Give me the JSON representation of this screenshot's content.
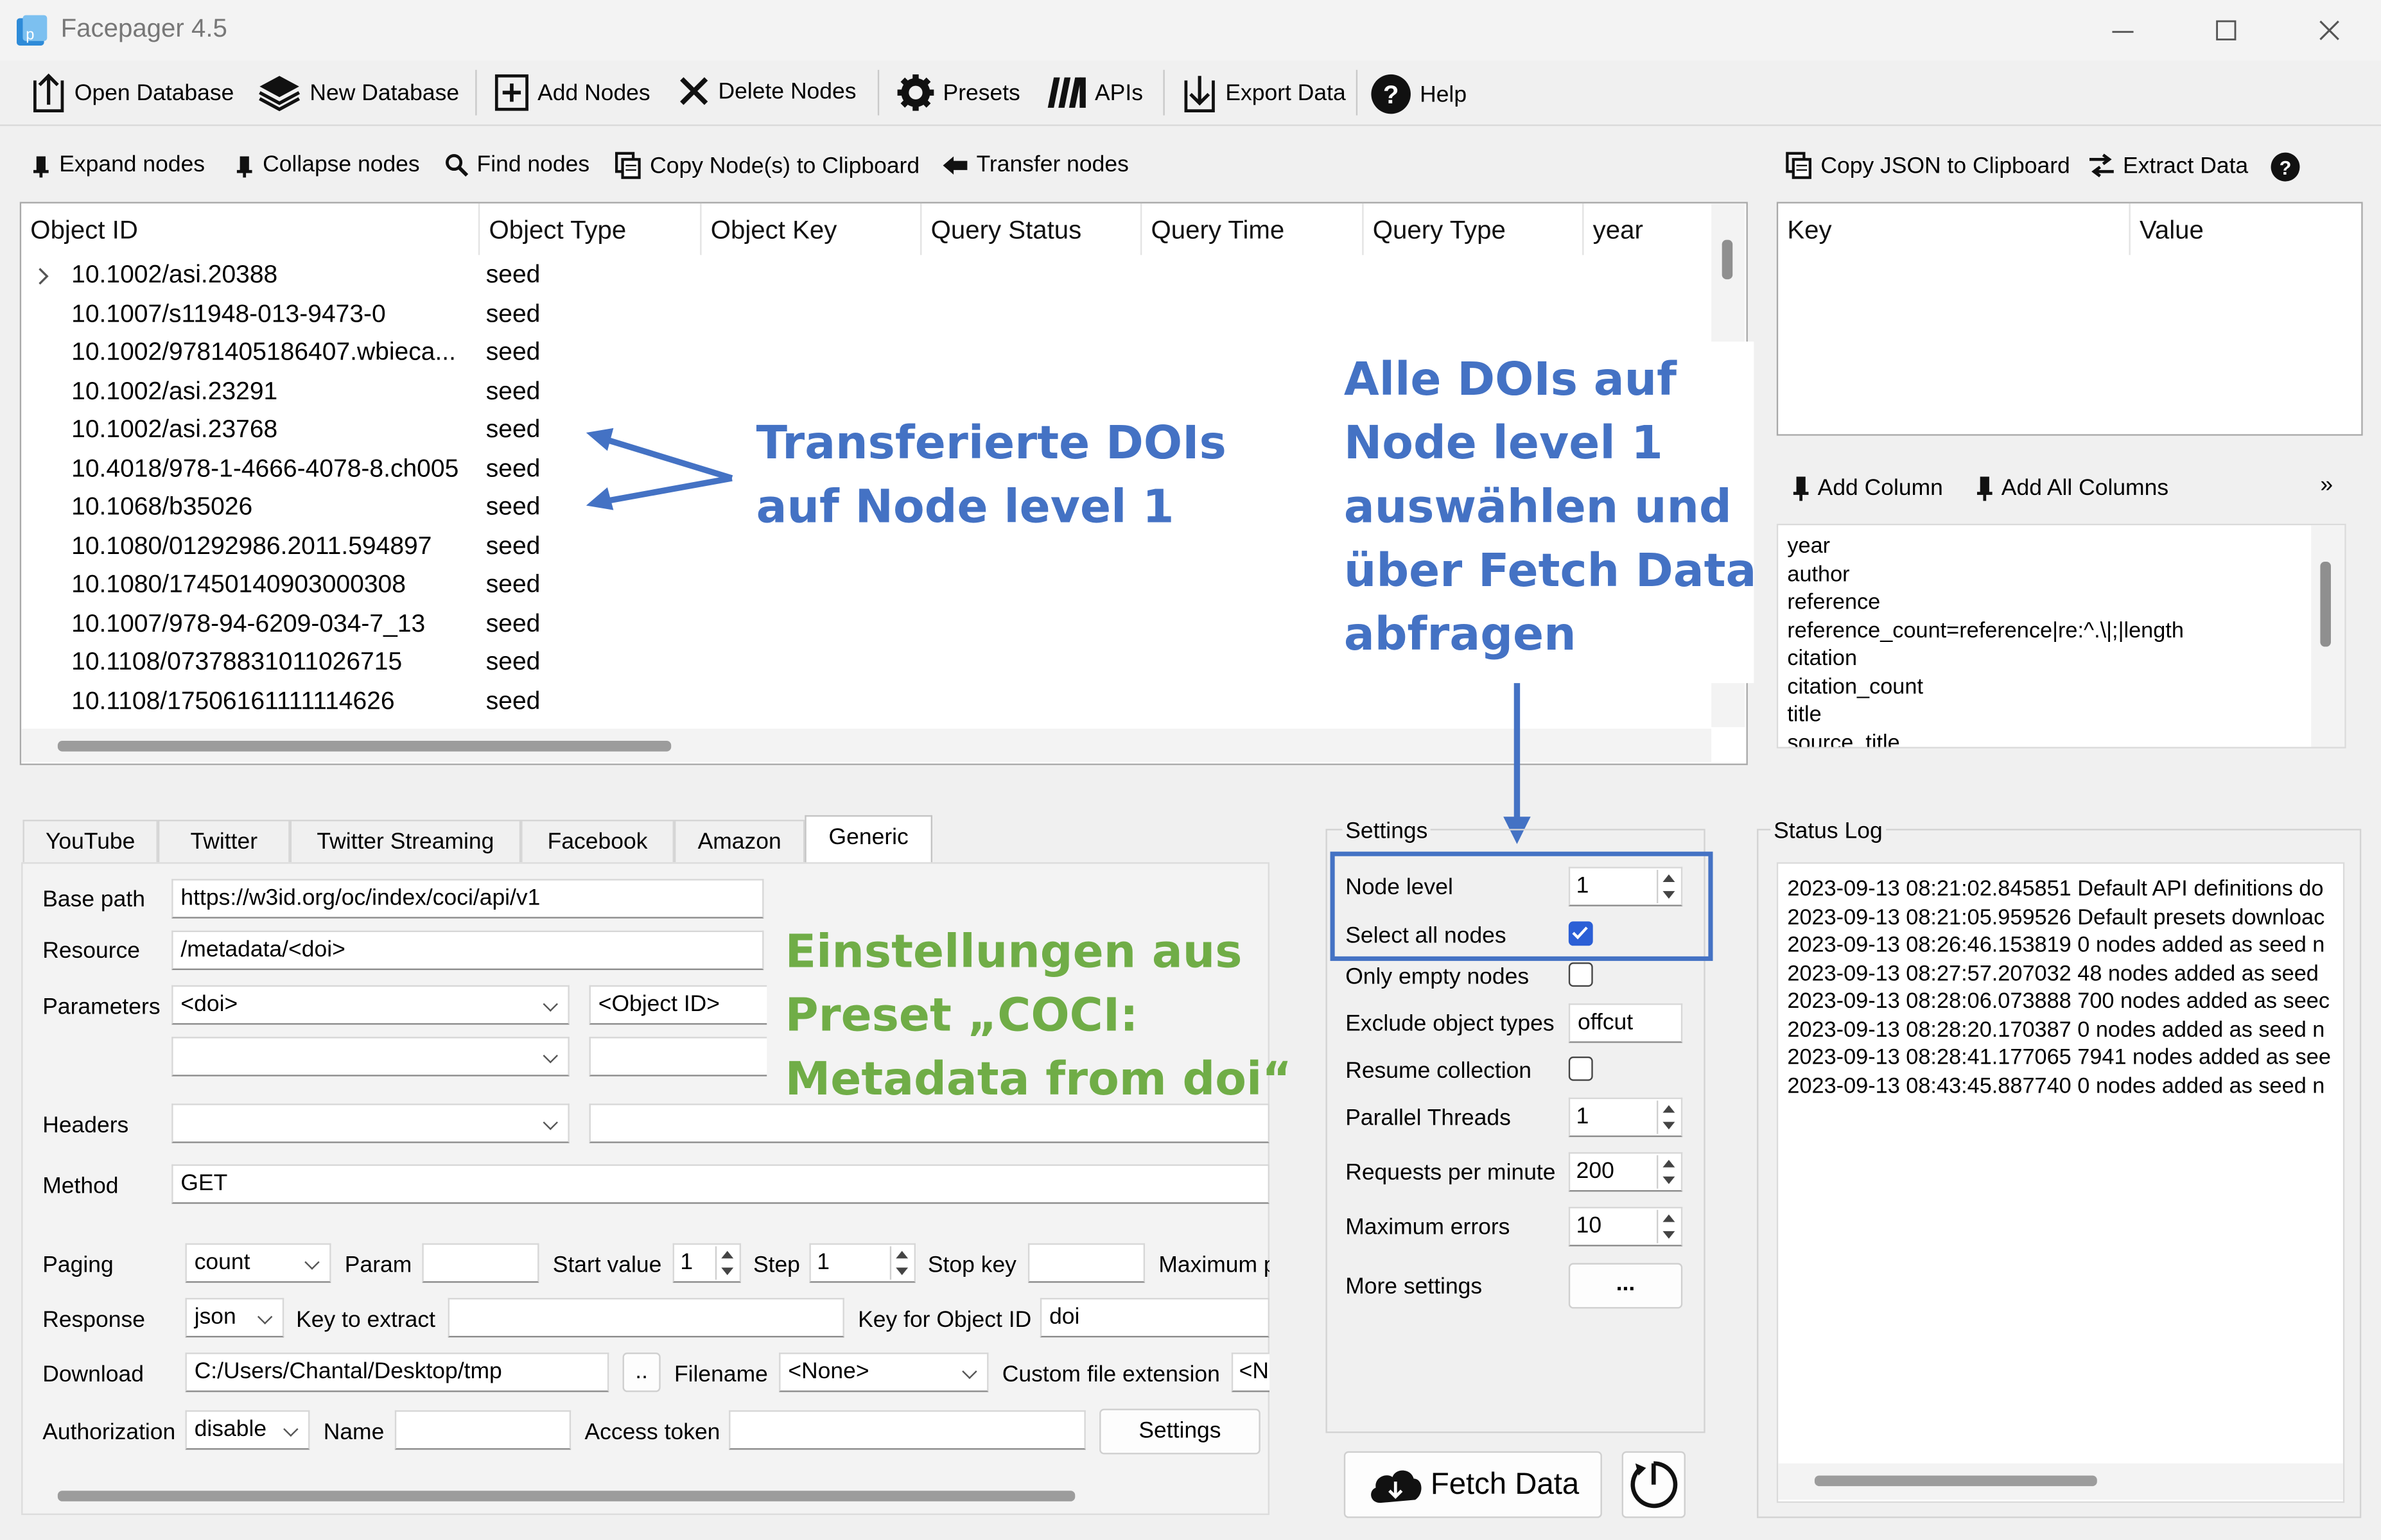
{
  "window": {
    "title": "Facepager 4.5"
  },
  "main_toolbar": [
    {
      "label": "Open Database"
    },
    {
      "label": "New Database"
    },
    {
      "label": "Add Nodes"
    },
    {
      "label": "Delete Nodes"
    },
    {
      "label": "Presets"
    },
    {
      "label": "APIs"
    },
    {
      "label": "Export Data"
    },
    {
      "label": "Help"
    }
  ],
  "tree_toolbar": {
    "expand": "Expand nodes",
    "collapse": "Collapse nodes",
    "find": "Find nodes",
    "copy_nodes": "Copy Node(s) to Clipboard",
    "transfer": "Transfer nodes"
  },
  "detail_toolbar": {
    "copy_json": "Copy JSON to Clipboard",
    "extract": "Extract Data"
  },
  "tree": {
    "columns": [
      "Object ID",
      "Object Type",
      "Object Key",
      "Query Status",
      "Query Time",
      "Query Type",
      "year"
    ],
    "rows": [
      {
        "id": "10.1002/asi.20388",
        "type": "seed"
      },
      {
        "id": "10.1007/s11948-013-9473-0",
        "type": "seed"
      },
      {
        "id": "10.1002/9781405186407.wbieca...",
        "type": "seed"
      },
      {
        "id": "10.1002/asi.23291",
        "type": "seed"
      },
      {
        "id": "10.1002/asi.23768",
        "type": "seed"
      },
      {
        "id": "10.4018/978-1-4666-4078-8.ch005",
        "type": "seed"
      },
      {
        "id": "10.1068/b35026",
        "type": "seed"
      },
      {
        "id": "10.1080/01292986.2011.594897",
        "type": "seed"
      },
      {
        "id": "10.1080/17450140903000308",
        "type": "seed"
      },
      {
        "id": "10.1007/978-94-6209-034-7_13",
        "type": "seed"
      },
      {
        "id": "10.1108/07378831011026715",
        "type": "seed"
      },
      {
        "id": "10.1108/17506161111114626",
        "type": "seed"
      }
    ]
  },
  "detail": {
    "key_header": "Key",
    "value_header": "Value"
  },
  "columns_panel": {
    "add_column": "Add Column",
    "add_all": "Add All Columns",
    "more": "»",
    "lines": [
      "year",
      "author",
      "reference",
      "reference_count=reference|re:^.\\|;|length",
      "citation",
      "citation_count",
      "title",
      "source_title"
    ]
  },
  "annotations": {
    "transfer_line1": "Transferierte DOIs",
    "transfer_line2": "auf Node level 1",
    "select_line1": "Alle DOIs auf",
    "select_line2": "Node level 1",
    "select_line3": "auswählen und",
    "select_line4": "über Fetch Data",
    "select_line5": "abfragen",
    "preset_line1": "Einstellungen aus",
    "preset_line2": "Preset „COCI:",
    "preset_line3": "Metadata from doi“"
  },
  "tabs": [
    "YouTube",
    "Twitter",
    "Twitter Streaming",
    "Facebook",
    "Amazon",
    "Generic"
  ],
  "generic": {
    "base_path_label": "Base path",
    "base_path": "https://w3id.org/oc/index/coci/api/v1",
    "resource_label": "Resource",
    "resource": "/metadata/<doi>",
    "parameters_label": "Parameters",
    "param1_key": "<doi>",
    "param1_value": "<Object ID>",
    "headers_label": "Headers",
    "method_label": "Method",
    "method": "GET",
    "paging_label": "Paging",
    "paging": "count",
    "param_label": "Param",
    "start_label": "Start value",
    "start_value": "1",
    "step_label": "Step",
    "step_value": "1",
    "stop_label": "Stop key",
    "maximum_label": "Maximum p",
    "response_label": "Response",
    "response": "json",
    "key_extract_label": "Key to extract",
    "key_object_label": "Key for Object ID",
    "key_object": "doi",
    "download_label": "Download",
    "download_path": "C:/Users/Chantal/Desktop/tmp",
    "browse": "..",
    "filename_label": "Filename",
    "filename": "<None>",
    "ext_label": "Custom file extension",
    "ext_value": "<N",
    "auth_label": "Authorization",
    "auth": "disable",
    "name_label": "Name",
    "token_label": "Access token",
    "settings_button": "Settings"
  },
  "settings": {
    "title": "Settings",
    "node_level_label": "Node level",
    "node_level": "1",
    "select_all_label": "Select all nodes",
    "select_all_checked": true,
    "only_empty_label": "Only empty nodes",
    "exclude_label": "Exclude object types",
    "exclude_value": "offcut",
    "resume_label": "Resume collection",
    "threads_label": "Parallel Threads",
    "threads": "1",
    "rpm_label": "Requests per minute",
    "rpm": "200",
    "max_errors_label": "Maximum errors",
    "max_errors": "10",
    "more_label": "More settings",
    "more_button": "..."
  },
  "fetch": {
    "label": "Fetch Data"
  },
  "status_log": {
    "title": "Status Log",
    "lines": [
      "2023-09-13 08:21:02.845851 Default API definitions do",
      "2023-09-13 08:21:05.959526 Default presets downloac",
      "2023-09-13 08:26:46.153819 0 nodes added as seed n",
      "2023-09-13 08:27:57.207032 48 nodes added as seed",
      "2023-09-13 08:28:06.073888 700 nodes added as seec",
      "2023-09-13 08:28:20.170387 0 nodes added as seed n",
      "2023-09-13 08:28:41.177065 7941 nodes added as see",
      "2023-09-13 08:43:45.887740 0 nodes added as seed n"
    ]
  },
  "colors": {
    "annotation_blue": "#4472c4",
    "annotation_green": "#70ad47",
    "checkbox": "#2b5fd6"
  }
}
